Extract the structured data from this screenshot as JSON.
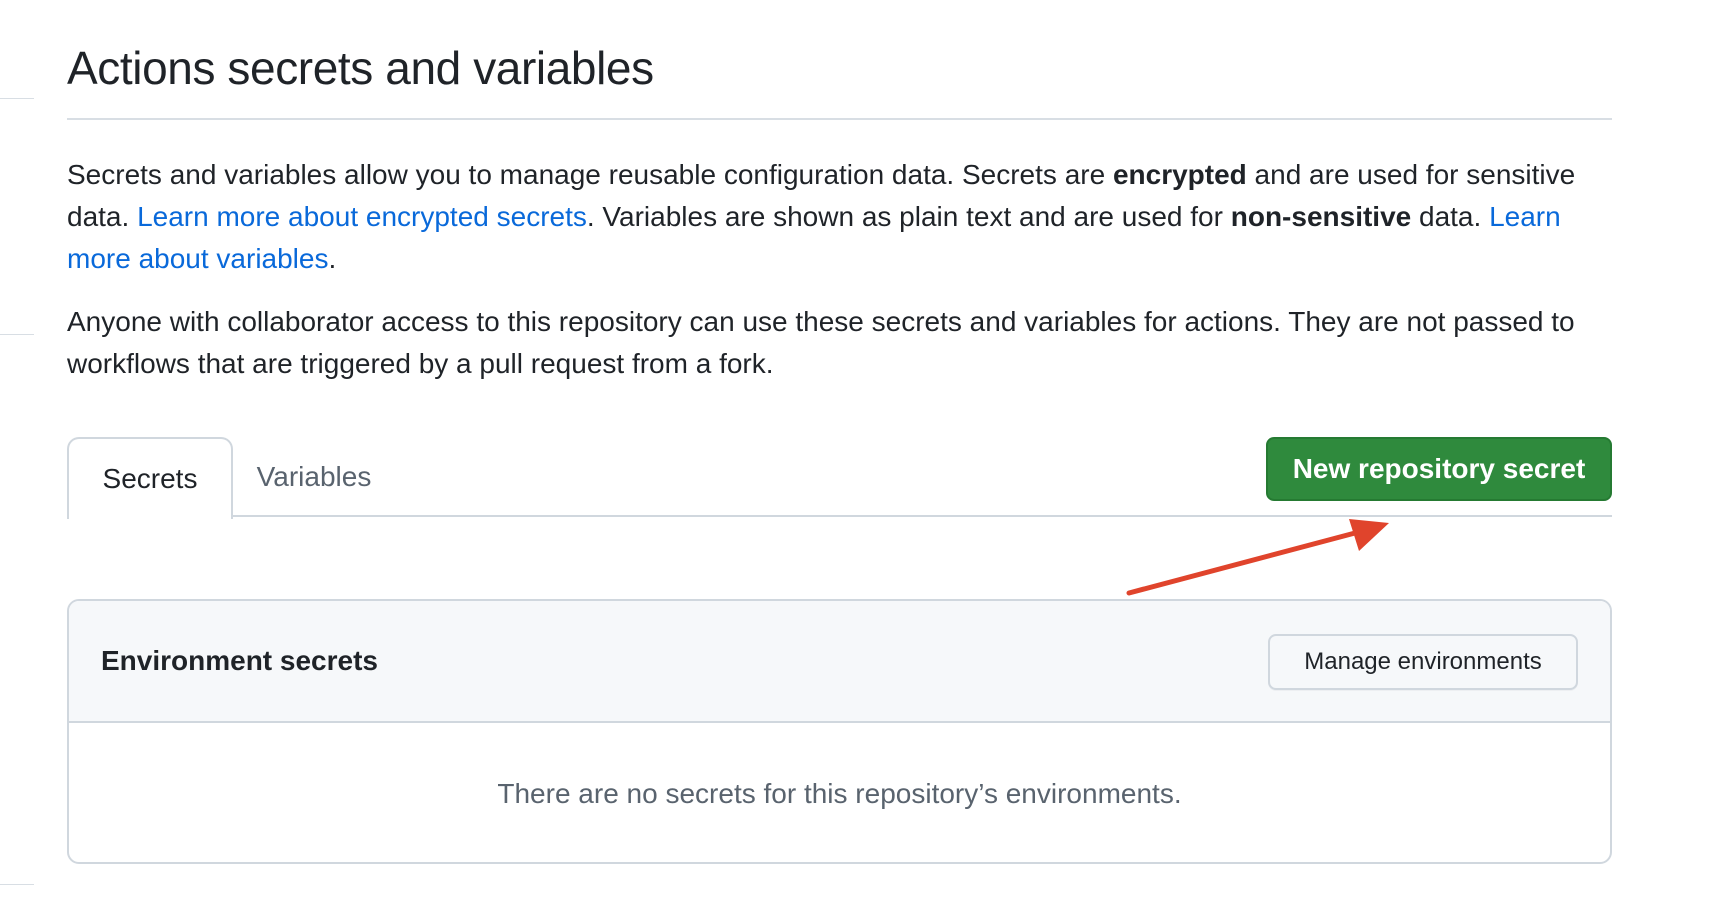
{
  "page": {
    "title": "Actions secrets and variables"
  },
  "description": {
    "p1_part1": "Secrets and variables allow you to manage reusable configuration data. Secrets are ",
    "p1_bold1": "encrypted",
    "p1_part2": " and are used for sensitive data. ",
    "p1_link1": "Learn more about encrypted secrets",
    "p1_part3": ". Variables are shown as plain text and are used for ",
    "p1_bold2": "non-sensitive",
    "p1_part4": " data. ",
    "p1_link2": "Learn more about variables",
    "p1_part5": ".",
    "p2": "Anyone with collaborator access to this repository can use these secrets and variables for actions. They are not passed to workflows that are triggered by a pull request from a fork."
  },
  "tabs": [
    {
      "label": "Secrets",
      "active": true
    },
    {
      "label": "Variables",
      "active": false
    }
  ],
  "actions": {
    "new_secret_label": "New repository secret"
  },
  "environment_secrets": {
    "title": "Environment secrets",
    "manage_label": "Manage environments",
    "empty_message": "There are no secrets for this repository’s environments."
  },
  "colors": {
    "primary_button": "#2f8a3d",
    "link": "#0969da",
    "annotation_arrow": "#e0442c"
  }
}
